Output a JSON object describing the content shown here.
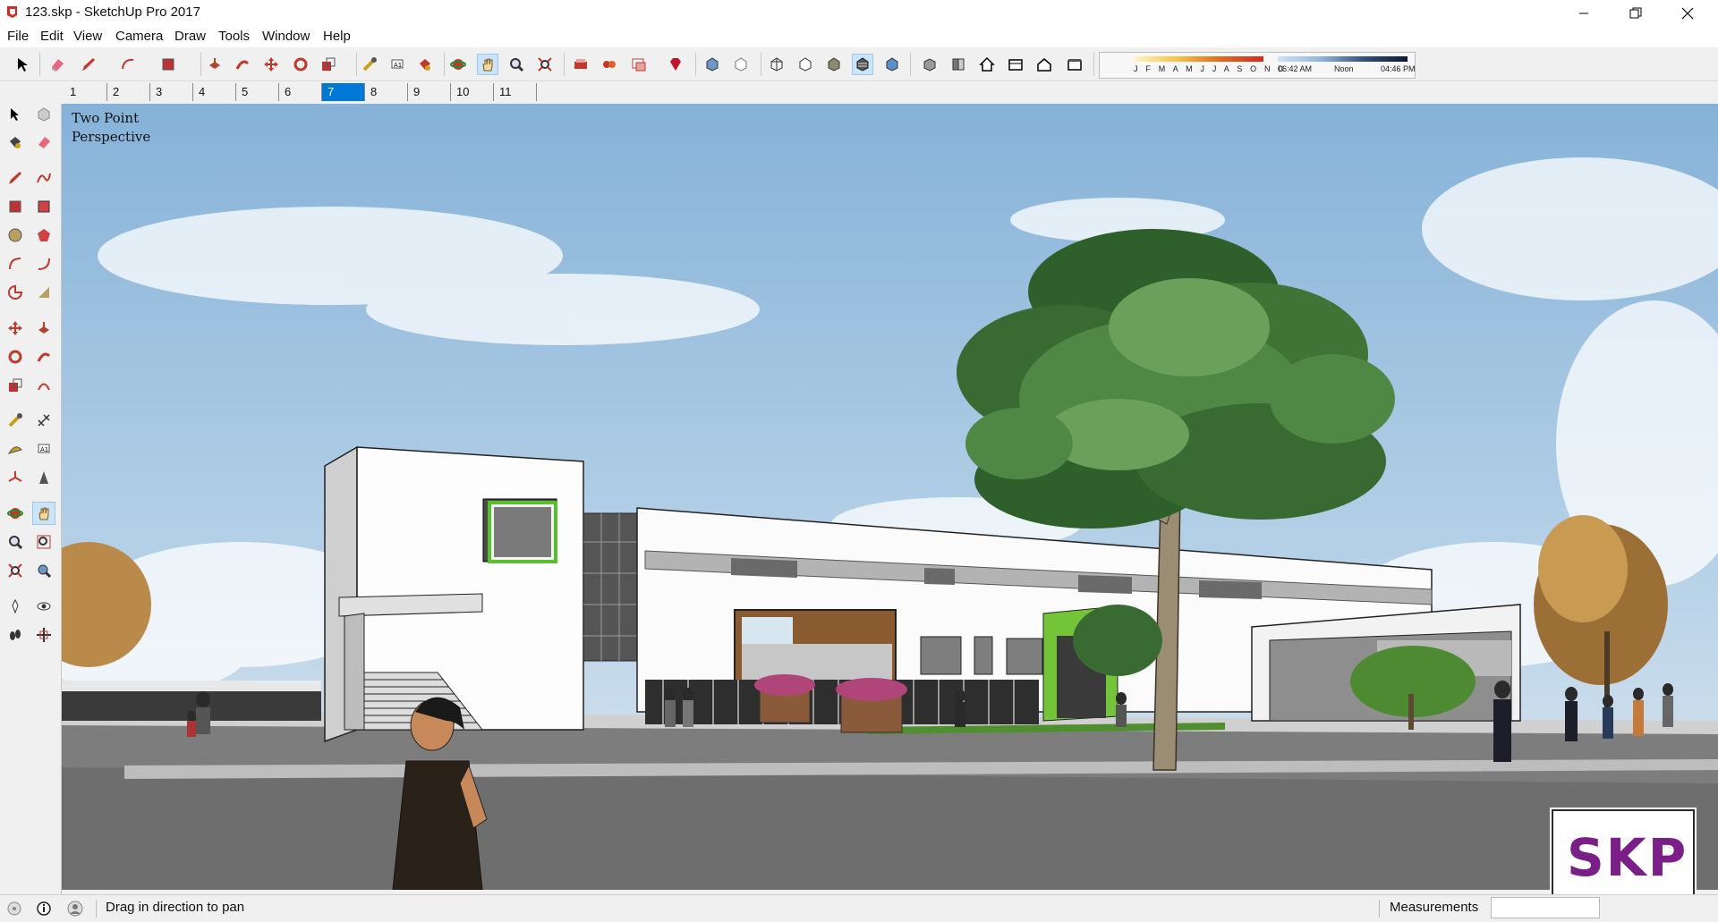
{
  "window": {
    "title": "123.skp - SketchUp Pro 2017",
    "controls": [
      "minimize",
      "maximize",
      "close"
    ]
  },
  "menu": [
    "File",
    "Edit",
    "View",
    "Camera",
    "Draw",
    "Tools",
    "Window",
    "Help"
  ],
  "toolbar": {
    "icons": [
      "select-icon",
      "eraser-icon",
      "pencil-icon",
      "arc-icon",
      "rectangle-icon",
      "push-pull-icon",
      "follow-me-icon",
      "move-icon",
      "rotate-icon",
      "scale-icon",
      "tape-measure-icon",
      "text-icon",
      "paint-bucket-icon",
      "orbit-icon",
      "pan-icon",
      "zoom-icon",
      "zoom-extents-icon",
      "3d-warehouse-icon",
      "extension-warehouse-icon",
      "layout-icon",
      "ruby-icon",
      "xray-icon",
      "back-edges-icon",
      "wireframe-icon",
      "hidden-line-icon",
      "shaded-icon",
      "shaded-textures-icon",
      "monochrome-icon",
      "iso-view-icon",
      "top-view-icon",
      "front-view-icon",
      "right-view-icon",
      "back-view-icon",
      "left-view-icon",
      "shadows-icon"
    ],
    "active": "pan-icon"
  },
  "shadow_settings": {
    "months": "J F M A M J J A S O N D",
    "time_start": "06:42 AM",
    "time_mid": "Noon",
    "time_end": "04:46 PM"
  },
  "scenes": [
    "1",
    "2",
    "3",
    "4",
    "5",
    "6",
    "7",
    "8",
    "9",
    "10",
    "11"
  ],
  "active_scene": "7",
  "viewport": {
    "camera_label_line1": "Two Point",
    "camera_label_line2": "Perspective"
  },
  "watermark": "SKP",
  "status": {
    "message": "Drag in direction to pan",
    "measurements_label": "Measurements",
    "measurements_value": ""
  },
  "colors": {
    "accent": "#0078d7",
    "sky": "#9cc1df",
    "logo": "#7b1f88",
    "building_green": "#74c43a"
  }
}
